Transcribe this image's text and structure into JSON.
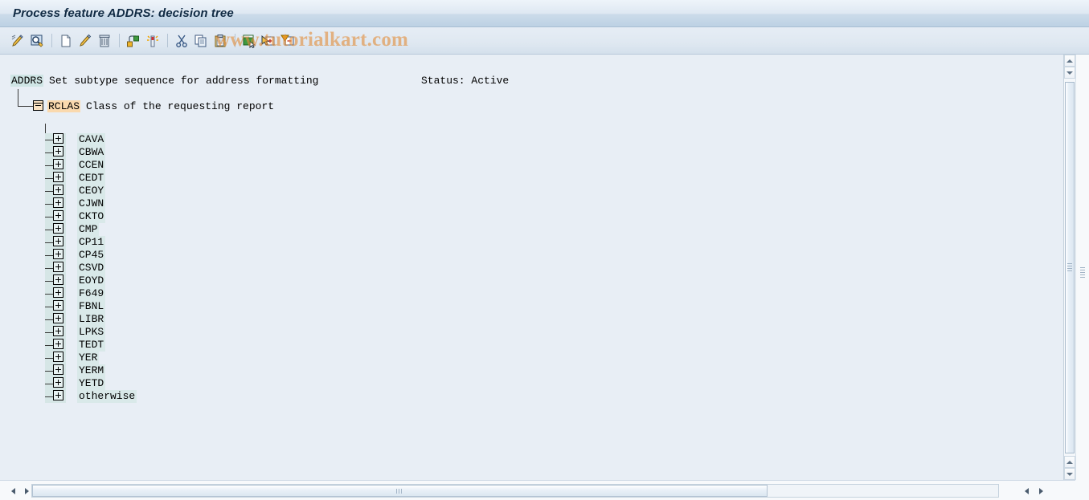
{
  "window": {
    "title": "Process feature ADDRS: decision tree"
  },
  "toolbar": {
    "buttons": [
      {
        "name": "test-feature-icon",
        "label": "Test feature"
      },
      {
        "name": "display-search-icon",
        "label": "Display/Search"
      },
      {
        "name": "create-icon",
        "label": "Create"
      },
      {
        "name": "change-icon",
        "label": "Change"
      },
      {
        "name": "delete-icon",
        "label": "Delete"
      },
      {
        "name": "structure-icon",
        "label": "Structure"
      },
      {
        "name": "generate-icon",
        "label": "Generate"
      },
      {
        "name": "cut-icon",
        "label": "Cut"
      },
      {
        "name": "copy-icon",
        "label": "Copy"
      },
      {
        "name": "paste-icon",
        "label": "Paste"
      },
      {
        "name": "insert-node-icon",
        "label": "Insert node"
      },
      {
        "name": "expand-node-icon",
        "label": "Expand node"
      },
      {
        "name": "collapse-node-icon",
        "label": "Collapse node"
      }
    ]
  },
  "watermark": {
    "text": "www.tutorialkart.com",
    "color": "#e28e3c"
  },
  "tree": {
    "root": {
      "key": "ADDRS",
      "description": "Set subtype sequence for address formatting",
      "key_background": "#cfe5e5"
    },
    "status": "Status: Active",
    "field_node": {
      "key": "RCLAS",
      "description": "Class of the requesting report",
      "key_background": "#fad9ae",
      "icon": "folder-open-icon",
      "expanded": true
    },
    "children": [
      {
        "label": "CAVA",
        "icon": "expand-plus-icon"
      },
      {
        "label": "CBWA",
        "icon": "expand-plus-icon"
      },
      {
        "label": "CCEN",
        "icon": "expand-plus-icon"
      },
      {
        "label": "CEDT",
        "icon": "expand-plus-icon"
      },
      {
        "label": "CEOY",
        "icon": "expand-plus-icon"
      },
      {
        "label": "CJWN",
        "icon": "expand-plus-icon"
      },
      {
        "label": "CKTO",
        "icon": "expand-plus-icon"
      },
      {
        "label": "CMP",
        "icon": "expand-plus-icon"
      },
      {
        "label": "CP11",
        "icon": "expand-plus-icon"
      },
      {
        "label": "CP45",
        "icon": "expand-plus-icon"
      },
      {
        "label": "CSVD",
        "icon": "expand-plus-icon"
      },
      {
        "label": "EOYD",
        "icon": "expand-plus-icon"
      },
      {
        "label": "F649",
        "icon": "expand-plus-icon"
      },
      {
        "label": "FBNL",
        "icon": "expand-plus-icon"
      },
      {
        "label": "LIBR",
        "icon": "expand-plus-icon"
      },
      {
        "label": "LPKS",
        "icon": "expand-plus-icon"
      },
      {
        "label": "TEDT",
        "icon": "expand-plus-icon"
      },
      {
        "label": "YER",
        "icon": "expand-plus-icon"
      },
      {
        "label": "YERM",
        "icon": "expand-plus-icon"
      },
      {
        "label": "YETD",
        "icon": "expand-plus-icon"
      },
      {
        "label": "otherwise",
        "icon": "expand-plus-icon"
      }
    ]
  },
  "scrollbars": {
    "vertical": {
      "up_arrow": "▲",
      "down_arrow": "▼"
    },
    "horizontal": {
      "left_arrow": "◀",
      "right_arrow": "▶"
    }
  }
}
